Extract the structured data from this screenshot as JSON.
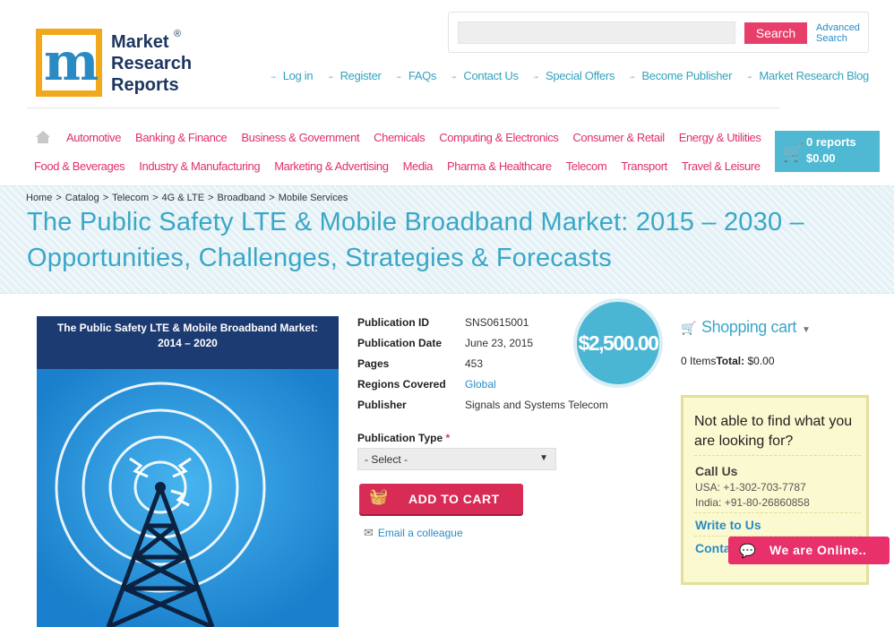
{
  "logo": {
    "line1": "Market",
    "line2": "Research",
    "line3": "Reports",
    "mark": "®"
  },
  "search": {
    "placeholder": "",
    "button_label": "Search",
    "advanced_line1": "Advanced",
    "advanced_line2": "Search"
  },
  "top_links": [
    "Log in",
    "Register",
    "FAQs",
    "Contact Us",
    "Special Offers",
    "Become Publisher",
    "Market Research Blog"
  ],
  "categories_row1": [
    "Automotive",
    "Banking & Finance",
    "Business & Government",
    "Chemicals",
    "Computing & Electronics",
    "Consumer & Retail",
    "Energy & Utilities"
  ],
  "categories_row2": [
    "Food & Beverages",
    "Industry & Manufacturing",
    "Marketing & Advertising",
    "Media",
    "Pharma & Healthcare",
    "Telecom",
    "Transport",
    "Travel & Leisure"
  ],
  "header_cart": {
    "reports": "0 reports",
    "total": "$0.00"
  },
  "breadcrumb": [
    "Home",
    "Catalog",
    "Telecom",
    "4G & LTE",
    "Broadband",
    "Mobile Services"
  ],
  "page_title": "The Public Safety LTE & Mobile Broadband Market: 2015 – 2030 – Opportunities, Challenges, Strategies & Forecasts",
  "product_image": {
    "title_line1": "The Public Safety LTE & Mobile Broadband Market:",
    "title_line2": "2014 – 2020"
  },
  "details": [
    {
      "key": "Publication ID",
      "value": "SNS0615001"
    },
    {
      "key": "Publication Date",
      "value": "June 23, 2015"
    },
    {
      "key": "Pages",
      "value": "453"
    },
    {
      "key": "Regions Covered",
      "value": "Global"
    },
    {
      "key": "Publisher",
      "value": "Signals and Systems Telecom"
    }
  ],
  "price": "$2,500.00",
  "publication_type": {
    "label": "Publication Type",
    "required": "*",
    "selected": "- Select -"
  },
  "add_to_cart_label": "ADD TO CART",
  "email_colleague_label": "Email a colleague",
  "shopping_cart": {
    "title": "Shopping cart",
    "items_count": "0 Items",
    "total_label": "Total:",
    "total_value": "$0.00"
  },
  "help": {
    "title": "Not able to find what you are looking for?",
    "call_us": "Call Us",
    "phone_usa": "USA: +1-302-703-7787",
    "phone_india": "India: +91-80-26860858",
    "write_us": "Write to Us",
    "contact": "Contact Market Research"
  },
  "chat": {
    "label": "We are Online.."
  },
  "colors": {
    "accent_pink": "#e0306a",
    "accent_blue": "#3aa7c8",
    "header_cart_bg": "#4fb8d2"
  }
}
